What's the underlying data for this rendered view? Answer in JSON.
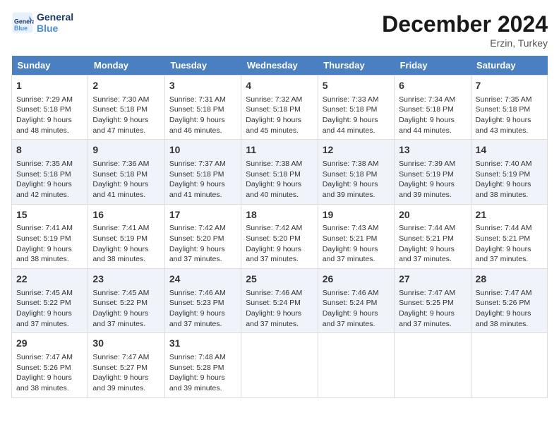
{
  "header": {
    "logo_line1": "General",
    "logo_line2": "Blue",
    "title": "December 2024",
    "subtitle": "Erzin, Turkey"
  },
  "days_of_week": [
    "Sunday",
    "Monday",
    "Tuesday",
    "Wednesday",
    "Thursday",
    "Friday",
    "Saturday"
  ],
  "weeks": [
    [
      {
        "day": 1,
        "sunrise": "7:29 AM",
        "sunset": "5:18 PM",
        "daylight": "9 hours and 48 minutes."
      },
      {
        "day": 2,
        "sunrise": "7:30 AM",
        "sunset": "5:18 PM",
        "daylight": "9 hours and 47 minutes."
      },
      {
        "day": 3,
        "sunrise": "7:31 AM",
        "sunset": "5:18 PM",
        "daylight": "9 hours and 46 minutes."
      },
      {
        "day": 4,
        "sunrise": "7:32 AM",
        "sunset": "5:18 PM",
        "daylight": "9 hours and 45 minutes."
      },
      {
        "day": 5,
        "sunrise": "7:33 AM",
        "sunset": "5:18 PM",
        "daylight": "9 hours and 44 minutes."
      },
      {
        "day": 6,
        "sunrise": "7:34 AM",
        "sunset": "5:18 PM",
        "daylight": "9 hours and 44 minutes."
      },
      {
        "day": 7,
        "sunrise": "7:35 AM",
        "sunset": "5:18 PM",
        "daylight": "9 hours and 43 minutes."
      }
    ],
    [
      {
        "day": 8,
        "sunrise": "7:35 AM",
        "sunset": "5:18 PM",
        "daylight": "9 hours and 42 minutes."
      },
      {
        "day": 9,
        "sunrise": "7:36 AM",
        "sunset": "5:18 PM",
        "daylight": "9 hours and 41 minutes."
      },
      {
        "day": 10,
        "sunrise": "7:37 AM",
        "sunset": "5:18 PM",
        "daylight": "9 hours and 41 minutes."
      },
      {
        "day": 11,
        "sunrise": "7:38 AM",
        "sunset": "5:18 PM",
        "daylight": "9 hours and 40 minutes."
      },
      {
        "day": 12,
        "sunrise": "7:38 AM",
        "sunset": "5:18 PM",
        "daylight": "9 hours and 39 minutes."
      },
      {
        "day": 13,
        "sunrise": "7:39 AM",
        "sunset": "5:19 PM",
        "daylight": "9 hours and 39 minutes."
      },
      {
        "day": 14,
        "sunrise": "7:40 AM",
        "sunset": "5:19 PM",
        "daylight": "9 hours and 38 minutes."
      }
    ],
    [
      {
        "day": 15,
        "sunrise": "7:41 AM",
        "sunset": "5:19 PM",
        "daylight": "9 hours and 38 minutes."
      },
      {
        "day": 16,
        "sunrise": "7:41 AM",
        "sunset": "5:19 PM",
        "daylight": "9 hours and 38 minutes."
      },
      {
        "day": 17,
        "sunrise": "7:42 AM",
        "sunset": "5:20 PM",
        "daylight": "9 hours and 37 minutes."
      },
      {
        "day": 18,
        "sunrise": "7:42 AM",
        "sunset": "5:20 PM",
        "daylight": "9 hours and 37 minutes."
      },
      {
        "day": 19,
        "sunrise": "7:43 AM",
        "sunset": "5:21 PM",
        "daylight": "9 hours and 37 minutes."
      },
      {
        "day": 20,
        "sunrise": "7:44 AM",
        "sunset": "5:21 PM",
        "daylight": "9 hours and 37 minutes."
      },
      {
        "day": 21,
        "sunrise": "7:44 AM",
        "sunset": "5:21 PM",
        "daylight": "9 hours and 37 minutes."
      }
    ],
    [
      {
        "day": 22,
        "sunrise": "7:45 AM",
        "sunset": "5:22 PM",
        "daylight": "9 hours and 37 minutes."
      },
      {
        "day": 23,
        "sunrise": "7:45 AM",
        "sunset": "5:22 PM",
        "daylight": "9 hours and 37 minutes."
      },
      {
        "day": 24,
        "sunrise": "7:46 AM",
        "sunset": "5:23 PM",
        "daylight": "9 hours and 37 minutes."
      },
      {
        "day": 25,
        "sunrise": "7:46 AM",
        "sunset": "5:24 PM",
        "daylight": "9 hours and 37 minutes."
      },
      {
        "day": 26,
        "sunrise": "7:46 AM",
        "sunset": "5:24 PM",
        "daylight": "9 hours and 37 minutes."
      },
      {
        "day": 27,
        "sunrise": "7:47 AM",
        "sunset": "5:25 PM",
        "daylight": "9 hours and 37 minutes."
      },
      {
        "day": 28,
        "sunrise": "7:47 AM",
        "sunset": "5:26 PM",
        "daylight": "9 hours and 38 minutes."
      }
    ],
    [
      {
        "day": 29,
        "sunrise": "7:47 AM",
        "sunset": "5:26 PM",
        "daylight": "9 hours and 38 minutes."
      },
      {
        "day": 30,
        "sunrise": "7:47 AM",
        "sunset": "5:27 PM",
        "daylight": "9 hours and 39 minutes."
      },
      {
        "day": 31,
        "sunrise": "7:48 AM",
        "sunset": "5:28 PM",
        "daylight": "9 hours and 39 minutes."
      },
      null,
      null,
      null,
      null
    ]
  ]
}
